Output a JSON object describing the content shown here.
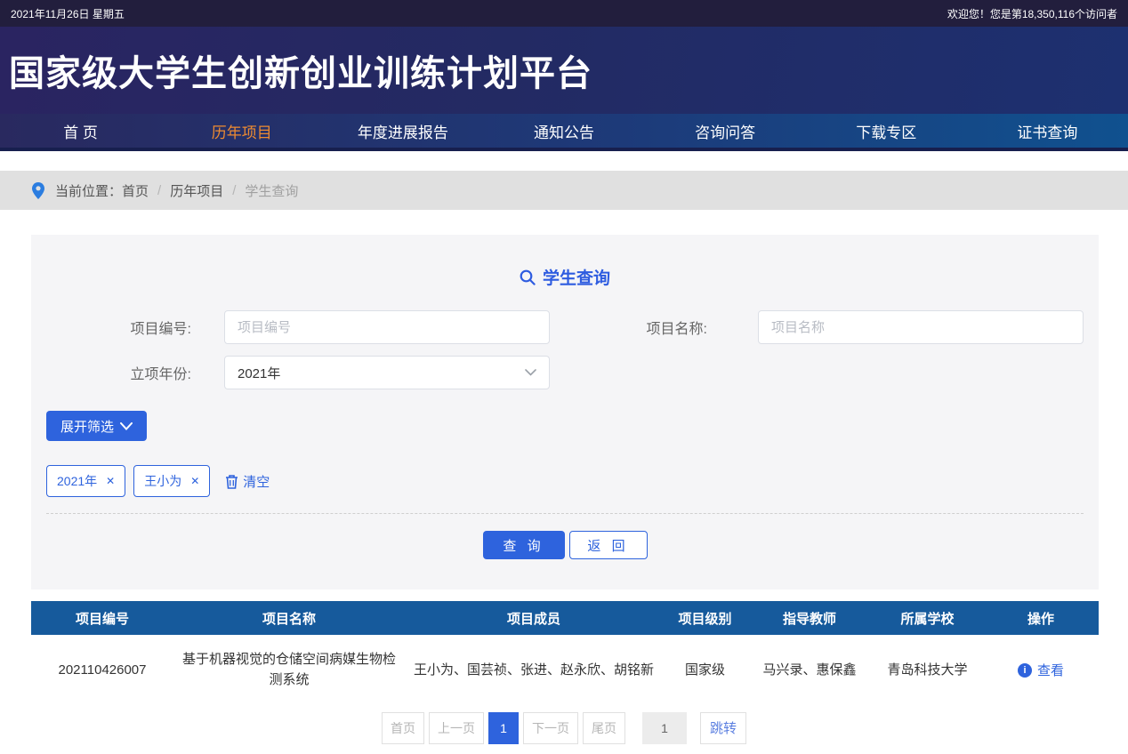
{
  "top_bar": {
    "date": "2021年11月26日 星期五",
    "welcome": "欢迎您！您是第18,350,116个访问者"
  },
  "header": {
    "title": "国家级大学生创新创业训练计划平台"
  },
  "nav": {
    "items": [
      {
        "label": "首 页",
        "active": false
      },
      {
        "label": "历年项目",
        "active": true
      },
      {
        "label": "年度进展报告",
        "active": false
      },
      {
        "label": "通知公告",
        "active": false
      },
      {
        "label": "咨询问答",
        "active": false
      },
      {
        "label": "下载专区",
        "active": false
      },
      {
        "label": "证书查询",
        "active": false
      }
    ]
  },
  "breadcrumb": {
    "prefix": "当前位置：",
    "items": [
      "首页",
      "历年项目",
      "学生查询"
    ],
    "separator": "/"
  },
  "search": {
    "title": "学生查询",
    "fields": {
      "project_code": {
        "label": "项目编号:",
        "placeholder": "项目编号",
        "value": ""
      },
      "project_name": {
        "label": "项目名称:",
        "placeholder": "项目名称",
        "value": ""
      },
      "year": {
        "label": "立项年份:",
        "value": "2021年"
      }
    },
    "expand_button": "展开筛选",
    "tags": [
      "2021年",
      "王小为"
    ],
    "clear_label": "清空",
    "query_button": "查 询",
    "back_button": "返 回"
  },
  "table": {
    "columns": [
      "项目编号",
      "项目名称",
      "项目成员",
      "项目级别",
      "指导教师",
      "所属学校",
      "操作"
    ],
    "rows": [
      {
        "code": "202110426007",
        "name": "基于机器视觉的仓储空间病媒生物检测系统",
        "members": "王小为、国芸祯、张进、赵永欣、胡铭新",
        "level": "国家级",
        "teachers": "马兴录、惠保鑫",
        "school": "青岛科技大学",
        "action": "查看"
      }
    ]
  },
  "pagination": {
    "first": "首页",
    "prev": "上一页",
    "current": "1",
    "next": "下一页",
    "last": "尾页",
    "jump_value": "1",
    "jump_label": "跳转"
  },
  "icons": {
    "tag_close": "✕",
    "info_glyph": "i"
  },
  "colors": {
    "accent": "#2e63dd",
    "nav_active": "#ee8b31",
    "table_header_bg": "#165a9c",
    "topbar_bg": "#221e3d"
  }
}
